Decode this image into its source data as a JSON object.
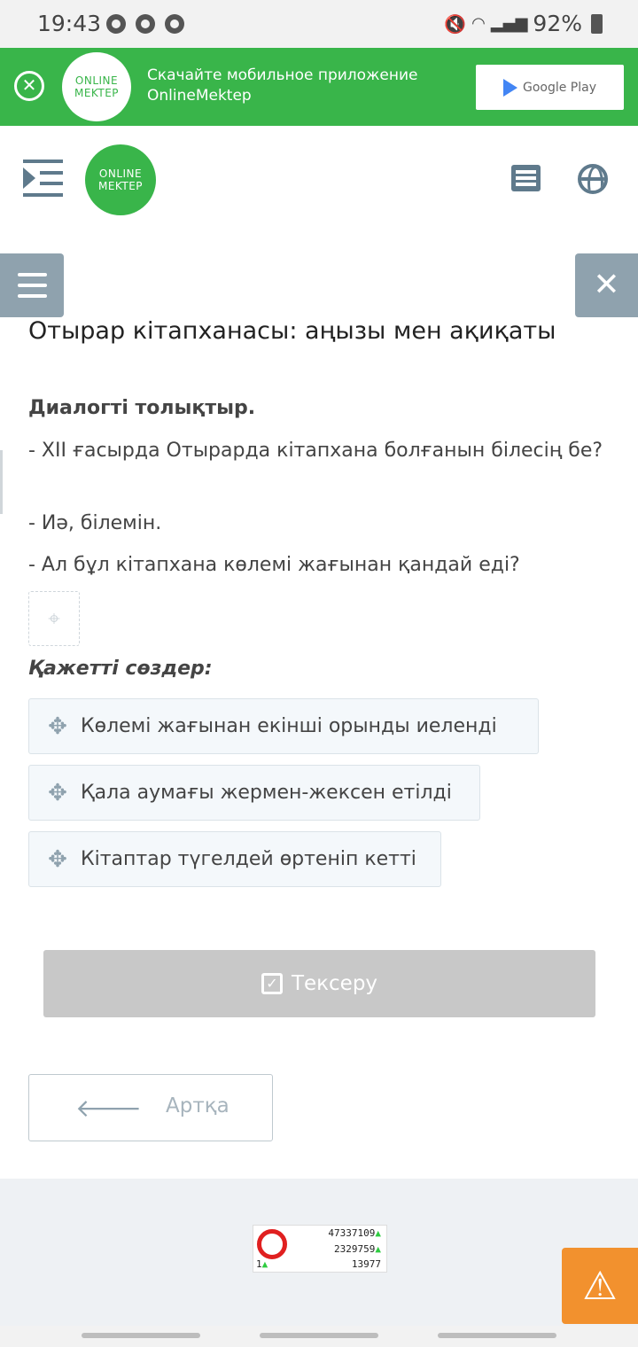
{
  "status_bar": {
    "time": "19:43",
    "battery": "92%"
  },
  "app_banner": {
    "text_line1": "Скачайте мобильное приложение",
    "text_line2": "OnlineMektep",
    "logo_line1": "ONLINE",
    "logo_line2": "MEKTEP",
    "store_label": "Google Play",
    "brand_color": "#39b54a"
  },
  "header": {
    "logo_line1": "ONLINE",
    "logo_line2": "MEKTEP"
  },
  "lesson": {
    "title": "Отырар кітапханасы: аңызы мен ақиқаты"
  },
  "task": {
    "title": "Диалогті толықтыр.",
    "dialog": [
      "- XII ғасырда Отырарда кітапхана болғанын білесің бе?",
      "- Иә, білемін.",
      "- Ал бұл кітапхана көлемі жағынан қандай еді?"
    ],
    "words_title": "Қажетті сөздер:",
    "words": [
      "Көлемі жағынан екінші орынды иеленді",
      "Қала аумағы жермен-жексен етілді",
      "Кітаптар түгелдей өртеніп кетті"
    ]
  },
  "buttons": {
    "check": "Тексеру",
    "back": "Артқа"
  },
  "counter": {
    "total": "47337109",
    "middle": "2329759",
    "today": "13977",
    "online": "1"
  }
}
